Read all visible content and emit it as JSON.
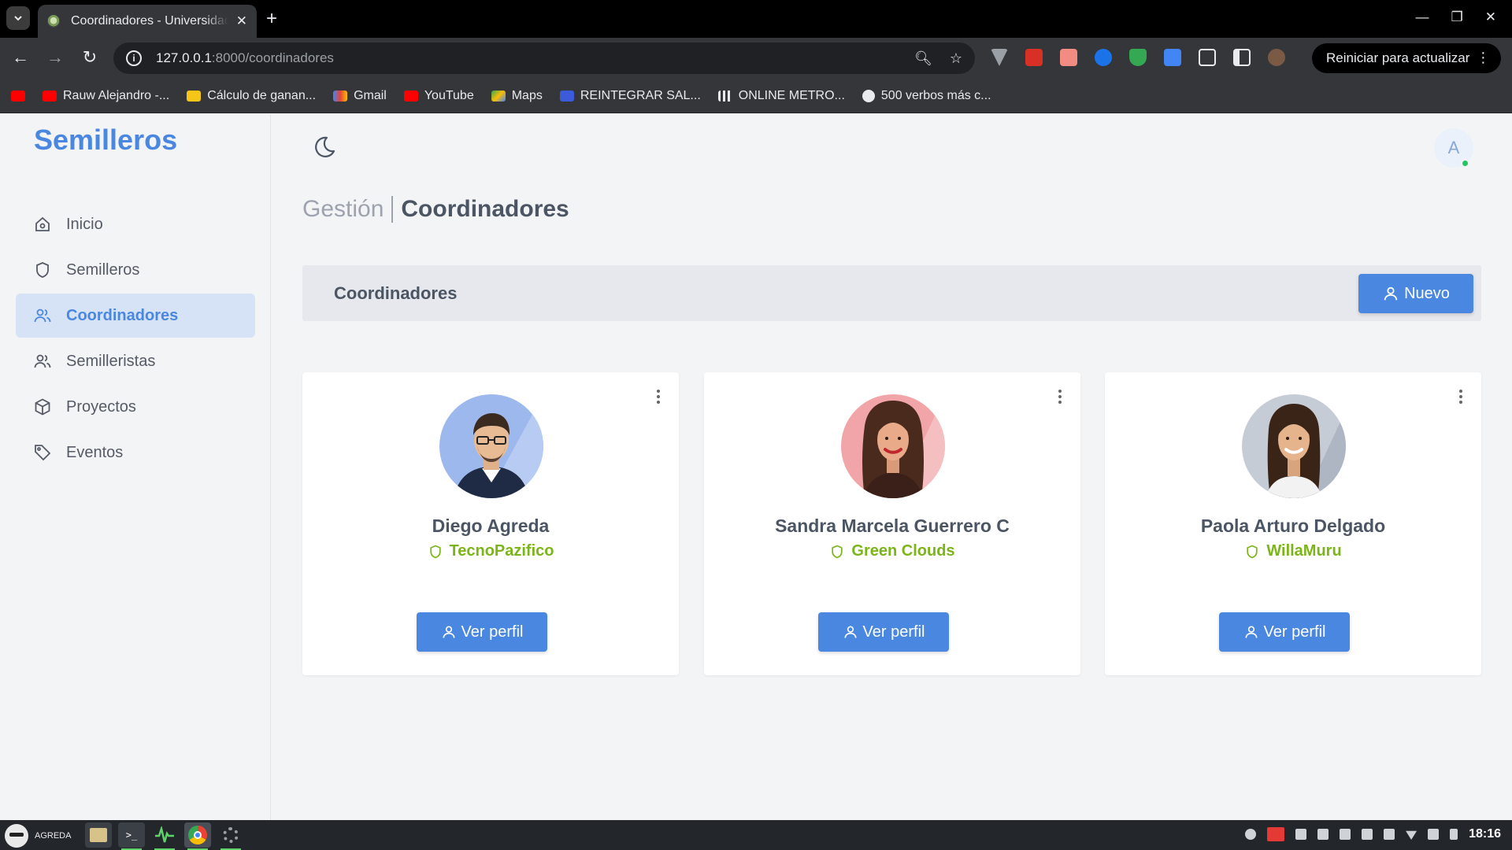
{
  "browser": {
    "tab_title": "Coordinadores - Universidad",
    "url_host": "127.0.0.1",
    "url_path": ":8000/coordinadores",
    "restart_label": "Reiniciar para actualizar",
    "bookmarks": [
      {
        "label": "",
        "icon": "youtube-icon",
        "color": "#ff0000"
      },
      {
        "label": "Rauw Alejandro -...",
        "icon": "youtube-icon",
        "color": "#ff0000"
      },
      {
        "label": "Cálculo de ganan...",
        "icon": "chart-icon",
        "color": "#f5c518"
      },
      {
        "label": "Gmail",
        "icon": "gmail-icon",
        "color": "#ea4335"
      },
      {
        "label": "YouTube",
        "icon": "youtube-icon",
        "color": "#ff0000"
      },
      {
        "label": "Maps",
        "icon": "maps-icon",
        "color": "#34a853"
      },
      {
        "label": "REINTEGRAR SAL...",
        "icon": "vs-icon",
        "color": "#3b5bdb"
      },
      {
        "label": "ONLINE METRO...",
        "icon": "bars-icon",
        "color": "#e8eaed"
      },
      {
        "label": "500 verbos más c...",
        "icon": "globe-icon",
        "color": "#e8eaed"
      }
    ]
  },
  "app": {
    "brand": "Semilleros",
    "nav": [
      {
        "label": "Inicio",
        "icon": "home-icon",
        "active": false
      },
      {
        "label": "Semilleros",
        "icon": "shield-icon",
        "active": false
      },
      {
        "label": "Coordinadores",
        "icon": "users-icon",
        "active": true
      },
      {
        "label": "Semilleristas",
        "icon": "users-icon",
        "active": false
      },
      {
        "label": "Proyectos",
        "icon": "box-icon",
        "active": false
      },
      {
        "label": "Eventos",
        "icon": "tag-icon",
        "active": false
      }
    ],
    "avatar_initial": "A",
    "breadcrumb_parent": "Gestión",
    "breadcrumb_current": "Coordinadores",
    "section_title": "Coordinadores",
    "new_button": "Nuevo",
    "cards": [
      {
        "name": "Diego Agreda",
        "group": "TecnoPazifico",
        "button": "Ver perfil",
        "photo_bg": "#9db8ec"
      },
      {
        "name": "Sandra Marcela Guerrero C",
        "group": "Green Clouds",
        "button": "Ver perfil",
        "photo_bg": "#f2a5a8"
      },
      {
        "name": "Paola Arturo Delgado",
        "group": "WillaMuru",
        "button": "Ver perfil",
        "photo_bg": "#c6ccd6"
      }
    ],
    "colors": {
      "accent": "#4a87e0",
      "group": "#7cb518"
    }
  },
  "taskbar": {
    "user": "AGREDA",
    "clock": "18:16"
  }
}
